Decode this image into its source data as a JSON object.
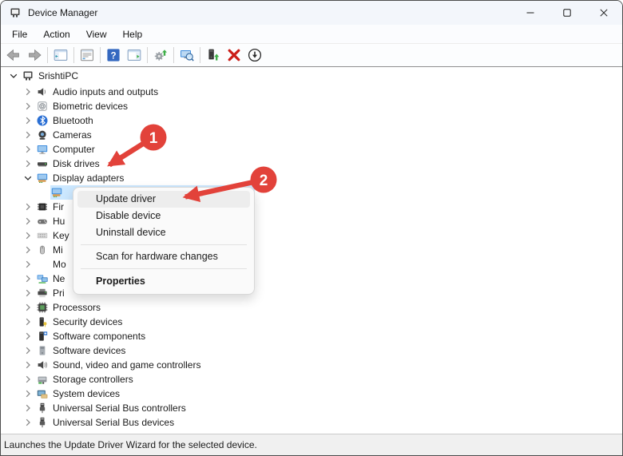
{
  "window": {
    "title": "Device Manager"
  },
  "titlebar": {
    "controls": [
      {
        "name": "minimize"
      },
      {
        "name": "maximize"
      },
      {
        "name": "close"
      }
    ]
  },
  "menu_bar": {
    "items": [
      "File",
      "Action",
      "View",
      "Help"
    ]
  },
  "toolbar": {
    "buttons": [
      "back",
      "forward",
      "|",
      "console-tree",
      "|",
      "properties",
      "|",
      "help",
      "action-pane",
      "|",
      "update-driver",
      "|",
      "scan-hardware",
      "|",
      "add-driver",
      "uninstall",
      "disable"
    ]
  },
  "tree": {
    "items": [
      {
        "label": "SrishtiPC",
        "level": 0,
        "expander": "expanded",
        "icon": "pc"
      },
      {
        "label": "Audio inputs and outputs",
        "level": 1,
        "expander": "collapsed",
        "icon": "audio"
      },
      {
        "label": "Biometric devices",
        "level": 1,
        "expander": "collapsed",
        "icon": "biometric"
      },
      {
        "label": "Bluetooth",
        "level": 1,
        "expander": "collapsed",
        "icon": "bluetooth"
      },
      {
        "label": "Cameras",
        "level": 1,
        "expander": "collapsed",
        "icon": "camera"
      },
      {
        "label": "Computer",
        "level": 1,
        "expander": "collapsed",
        "icon": "computer"
      },
      {
        "label": "Disk drives",
        "level": 1,
        "expander": "collapsed",
        "icon": "disk"
      },
      {
        "label": "Display adapters",
        "level": 1,
        "expander": "expanded",
        "icon": "display-adapter"
      },
      {
        "label": "",
        "level": 2,
        "expander": "none",
        "icon": "display-adapter",
        "selected": true
      },
      {
        "label": "Fir",
        "level": 1,
        "expander": "collapsed",
        "icon": "firmware"
      },
      {
        "label": "Hu",
        "level": 1,
        "expander": "collapsed",
        "icon": "hid"
      },
      {
        "label": "Key",
        "level": 1,
        "expander": "collapsed",
        "icon": "keyboard"
      },
      {
        "label": "Mi",
        "level": 1,
        "expander": "collapsed",
        "icon": "mouse"
      },
      {
        "label": "Mo",
        "level": 1,
        "expander": "collapsed",
        "icon": "monitor"
      },
      {
        "label": "Ne",
        "level": 1,
        "expander": "collapsed",
        "icon": "network"
      },
      {
        "label": "Pri",
        "level": 1,
        "expander": "collapsed",
        "icon": "printer"
      },
      {
        "label": "Processors",
        "level": 1,
        "expander": "collapsed",
        "icon": "processor"
      },
      {
        "label": "Security devices",
        "level": 1,
        "expander": "collapsed",
        "icon": "security"
      },
      {
        "label": "Software components",
        "level": 1,
        "expander": "collapsed",
        "icon": "software-component"
      },
      {
        "label": "Software devices",
        "level": 1,
        "expander": "collapsed",
        "icon": "software-device"
      },
      {
        "label": "Sound, video and game controllers",
        "level": 1,
        "expander": "collapsed",
        "icon": "sound"
      },
      {
        "label": "Storage controllers",
        "level": 1,
        "expander": "collapsed",
        "icon": "storage"
      },
      {
        "label": "System devices",
        "level": 1,
        "expander": "collapsed",
        "icon": "system"
      },
      {
        "label": "Universal Serial Bus controllers",
        "level": 1,
        "expander": "collapsed",
        "icon": "usb"
      },
      {
        "label": "Universal Serial Bus devices",
        "level": 1,
        "expander": "collapsed",
        "icon": "usb"
      }
    ]
  },
  "context_menu": {
    "items": [
      {
        "type": "item",
        "label": "Update driver",
        "highlighted": true
      },
      {
        "type": "item",
        "label": "Disable device"
      },
      {
        "type": "item",
        "label": "Uninstall device"
      },
      {
        "type": "separator"
      },
      {
        "type": "item",
        "label": "Scan for hardware changes"
      },
      {
        "type": "separator"
      },
      {
        "type": "item",
        "label": "Properties",
        "bold": true
      }
    ]
  },
  "annotations": [
    {
      "number": "1",
      "target": "Display adapters"
    },
    {
      "number": "2",
      "target": "Update driver"
    }
  ],
  "status_bar": {
    "text": "Launches the Update Driver Wizard for the selected device."
  },
  "colors": {
    "annotation_red": "#e2423a",
    "selection_blue": "#cce8ff",
    "menu_highlight": "#ededed"
  }
}
